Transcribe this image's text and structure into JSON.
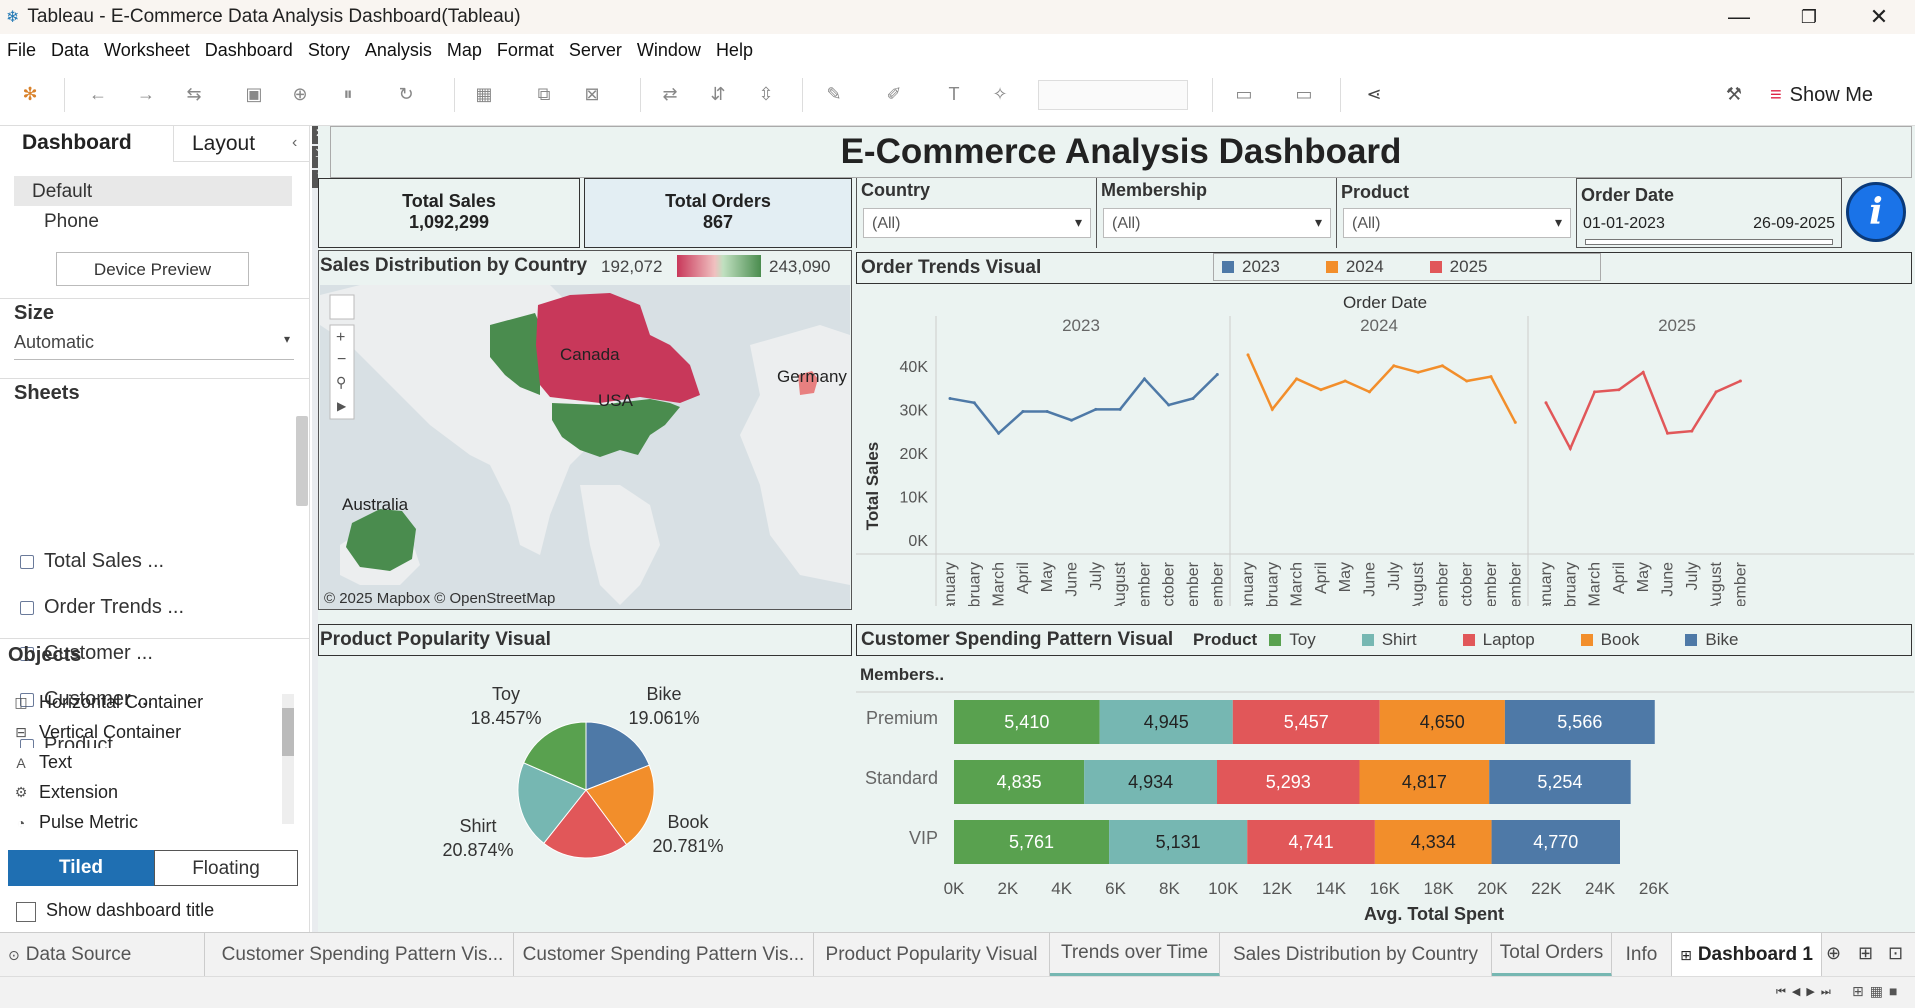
{
  "window": {
    "title": "Tableau - E-Commerce Data Analysis Dashboard(Tableau)"
  },
  "menu": [
    "File",
    "Data",
    "Worksheet",
    "Dashboard",
    "Story",
    "Analysis",
    "Map",
    "Format",
    "Server",
    "Window",
    "Help"
  ],
  "toolbar": {
    "show_me": "Show Me"
  },
  "left_panel": {
    "tabs": {
      "dashboard": "Dashboard",
      "layout": "Layout"
    },
    "device": {
      "default": "Default",
      "phone": "Phone",
      "preview": "Device Preview"
    },
    "size": {
      "label": "Size",
      "value": "Automatic"
    },
    "sheets_label": "Sheets",
    "sheets": [
      "Total Sales ...",
      "Order Trends ...",
      "Customer ...",
      "Customer ...",
      "Product ..."
    ],
    "objects_label": "Objects",
    "objects": [
      "Horizontal Container",
      "Vertical Container",
      "Text",
      "Extension",
      "Pulse Metric"
    ],
    "tiled": "Tiled",
    "floating": "Floating",
    "show_title": "Show dashboard title"
  },
  "dashboard": {
    "title": "E-Commerce Analysis Dashboard",
    "kpi": {
      "sales_label": "Total Sales",
      "sales_value": "1,092,299",
      "orders_label": "Total Orders",
      "orders_value": "867"
    },
    "filters": {
      "country": {
        "label": "Country",
        "value": "(All)"
      },
      "membership": {
        "label": "Membership",
        "value": "(All)"
      },
      "product": {
        "label": "Product",
        "value": "(All)"
      },
      "order_date": {
        "label": "Order Date",
        "start": "01-01-2023",
        "end": "26-09-2025"
      }
    },
    "map": {
      "title": "Sales Distribution by Country",
      "legend_min": "192,072",
      "legend_max": "243,090",
      "labels": [
        "Canada",
        "USA",
        "Germany",
        "Australia"
      ],
      "attribution": "© 2025 Mapbox © OpenStreetMap",
      "colors": {
        "high": "#c8385a",
        "low": "#4a8c4e"
      }
    },
    "trends_title": "Order Trends Visual",
    "pie_title": "Product Popularity Visual",
    "bars_title": "Customer Spending Pattern Visual"
  },
  "chart_data": [
    {
      "type": "line",
      "title": "Order Trends Visual",
      "xlabel": "Order Date",
      "ylabel": "Total Sales",
      "ylim": [
        0,
        45000
      ],
      "yticks": [
        "0K",
        "10K",
        "20K",
        "30K",
        "40K"
      ],
      "legend_position": "top",
      "months": [
        "January",
        "February",
        "March",
        "April",
        "May",
        "June",
        "July",
        "August",
        "September",
        "October",
        "November",
        "December"
      ],
      "series": [
        {
          "name": "2023",
          "color": "#4e79a7",
          "values": [
            32500,
            31500,
            24500,
            29500,
            29500,
            27500,
            30000,
            30000,
            37000,
            31000,
            32500,
            38000
          ]
        },
        {
          "name": "2024",
          "color": "#f28e2b",
          "values": [
            42500,
            30000,
            37000,
            34500,
            36500,
            34000,
            40000,
            38500,
            40000,
            36500,
            37500,
            27000
          ]
        },
        {
          "name": "2025",
          "color": "#e15759",
          "values": [
            31500,
            21000,
            34000,
            34500,
            38500,
            24500,
            25000,
            34000,
            36500
          ]
        }
      ]
    },
    {
      "type": "pie",
      "title": "Product Popularity Visual",
      "labels": [
        "Bike",
        "Book",
        "Laptop",
        "Shirt",
        "Toy"
      ],
      "values": [
        19.061,
        20.781,
        20.827,
        20.874,
        18.457
      ],
      "display": [
        "19.061%",
        "20.781%",
        "",
        "20.874%",
        "18.457%"
      ],
      "colors": [
        "#4e79a7",
        "#f28e2b",
        "#e15759",
        "#76b7b2",
        "#59a14f"
      ]
    },
    {
      "type": "bar",
      "stacked": true,
      "title": "Customer Spending Pattern Visual",
      "legend_title": "Product",
      "categories_label": "Members..",
      "categories": [
        "Premium",
        "Standard",
        "VIP"
      ],
      "xlabel": "Avg. Total Spent",
      "xlim": [
        0,
        26000
      ],
      "xticks": [
        "0K",
        "2K",
        "4K",
        "6K",
        "8K",
        "10K",
        "12K",
        "14K",
        "16K",
        "18K",
        "20K",
        "22K",
        "24K",
        "26K"
      ],
      "series": [
        {
          "name": "Toy",
          "color": "#59a14f",
          "values": [
            5410,
            4835,
            5761
          ]
        },
        {
          "name": "Shirt",
          "color": "#76b7b2",
          "values": [
            4945,
            4934,
            5131
          ]
        },
        {
          "name": "Laptop",
          "color": "#e15759",
          "values": [
            5457,
            5293,
            4741
          ]
        },
        {
          "name": "Book",
          "color": "#f28e2b",
          "values": [
            4650,
            4817,
            4334
          ]
        },
        {
          "name": "Bike",
          "color": "#4e79a7",
          "values": [
            5566,
            5254,
            4770
          ]
        }
      ]
    }
  ],
  "bottom_tabs": [
    "Data Source",
    "Customer Spending Pattern Vis...",
    "Customer Spending Pattern Vis...",
    "Product Popularity Visual",
    "Trends over Time",
    "Sales Distribution by Country",
    "Total Orders",
    "Info",
    "Dashboard 1"
  ]
}
